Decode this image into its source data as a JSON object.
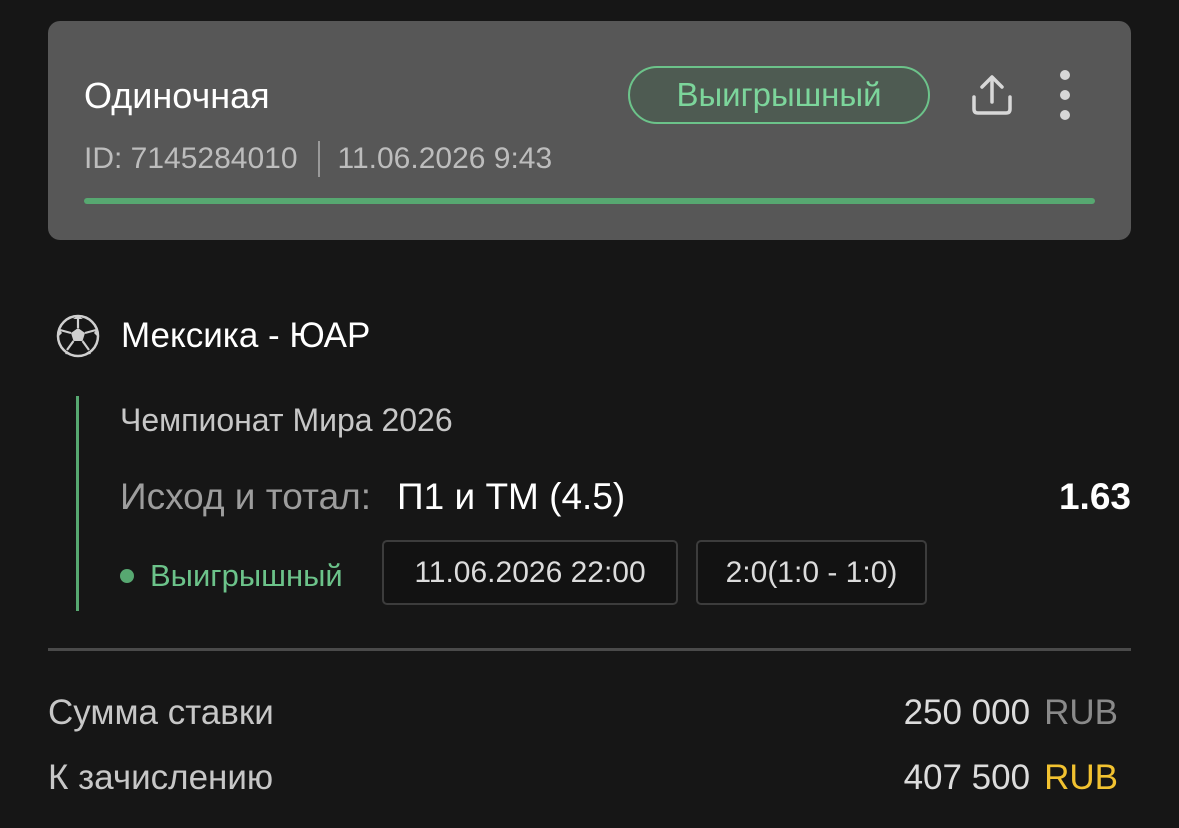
{
  "bet": {
    "type": "Одиночная",
    "status": "Выигрышный",
    "id": "ID: 7145284010",
    "placed_at": "11.06.2026 9:43",
    "progress": 1.0
  },
  "colors": {
    "accent_green": "#57a871",
    "currency_gold": "#f2c230",
    "card_bg": "#575757",
    "page_bg": "#161616"
  },
  "icons": {
    "share": "share-icon",
    "more": "more-vertical-icon",
    "sport": "soccer-ball-icon"
  },
  "event": {
    "match": "Мексика - ЮАР",
    "tournament": "Чемпионат Мира 2026",
    "market_label": "Исход и тотал:",
    "market_value": "П1 и ТМ (4.5)",
    "odds": "1.63",
    "status": "Выигрышный",
    "start_time": "11.06.2026 22:00",
    "score": "2:0(1:0 - 1:0)"
  },
  "summary": {
    "stake_label": "Сумма ставки",
    "stake_amount": "250 000",
    "stake_currency": "RUB",
    "payout_label": "К зачислению",
    "payout_amount": "407 500",
    "payout_currency": "RUB"
  }
}
